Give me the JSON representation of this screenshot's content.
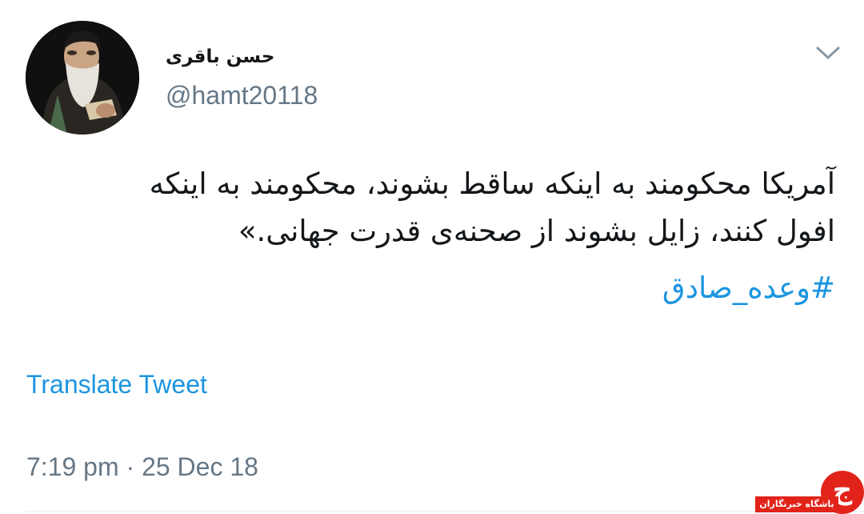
{
  "tweet": {
    "author": {
      "display_name": "حسن  باقری",
      "handle": "@hamt20118",
      "avatar_icon": "profile-photo"
    },
    "menu_icon": "chevron-down-icon",
    "text_lines": [
      "آمریکا محکومند به اینکه ساقط بشوند، محکومند به اینکه",
      "افول کنند، زایل بشوند از صحنه‌ی قدرت جهانی.»"
    ],
    "hashtag": "#وعده_صادق",
    "translate_label": "Translate Tweet",
    "timestamp": "7:19 pm · 25 Dec 18"
  },
  "watermark": {
    "logo_text": "ج",
    "label": "باشگاه خبرنگاران"
  },
  "colors": {
    "link": "#1b95e0",
    "secondary_text": "#657786",
    "primary_text": "#14171a",
    "watermark_red": "#e2231a"
  }
}
